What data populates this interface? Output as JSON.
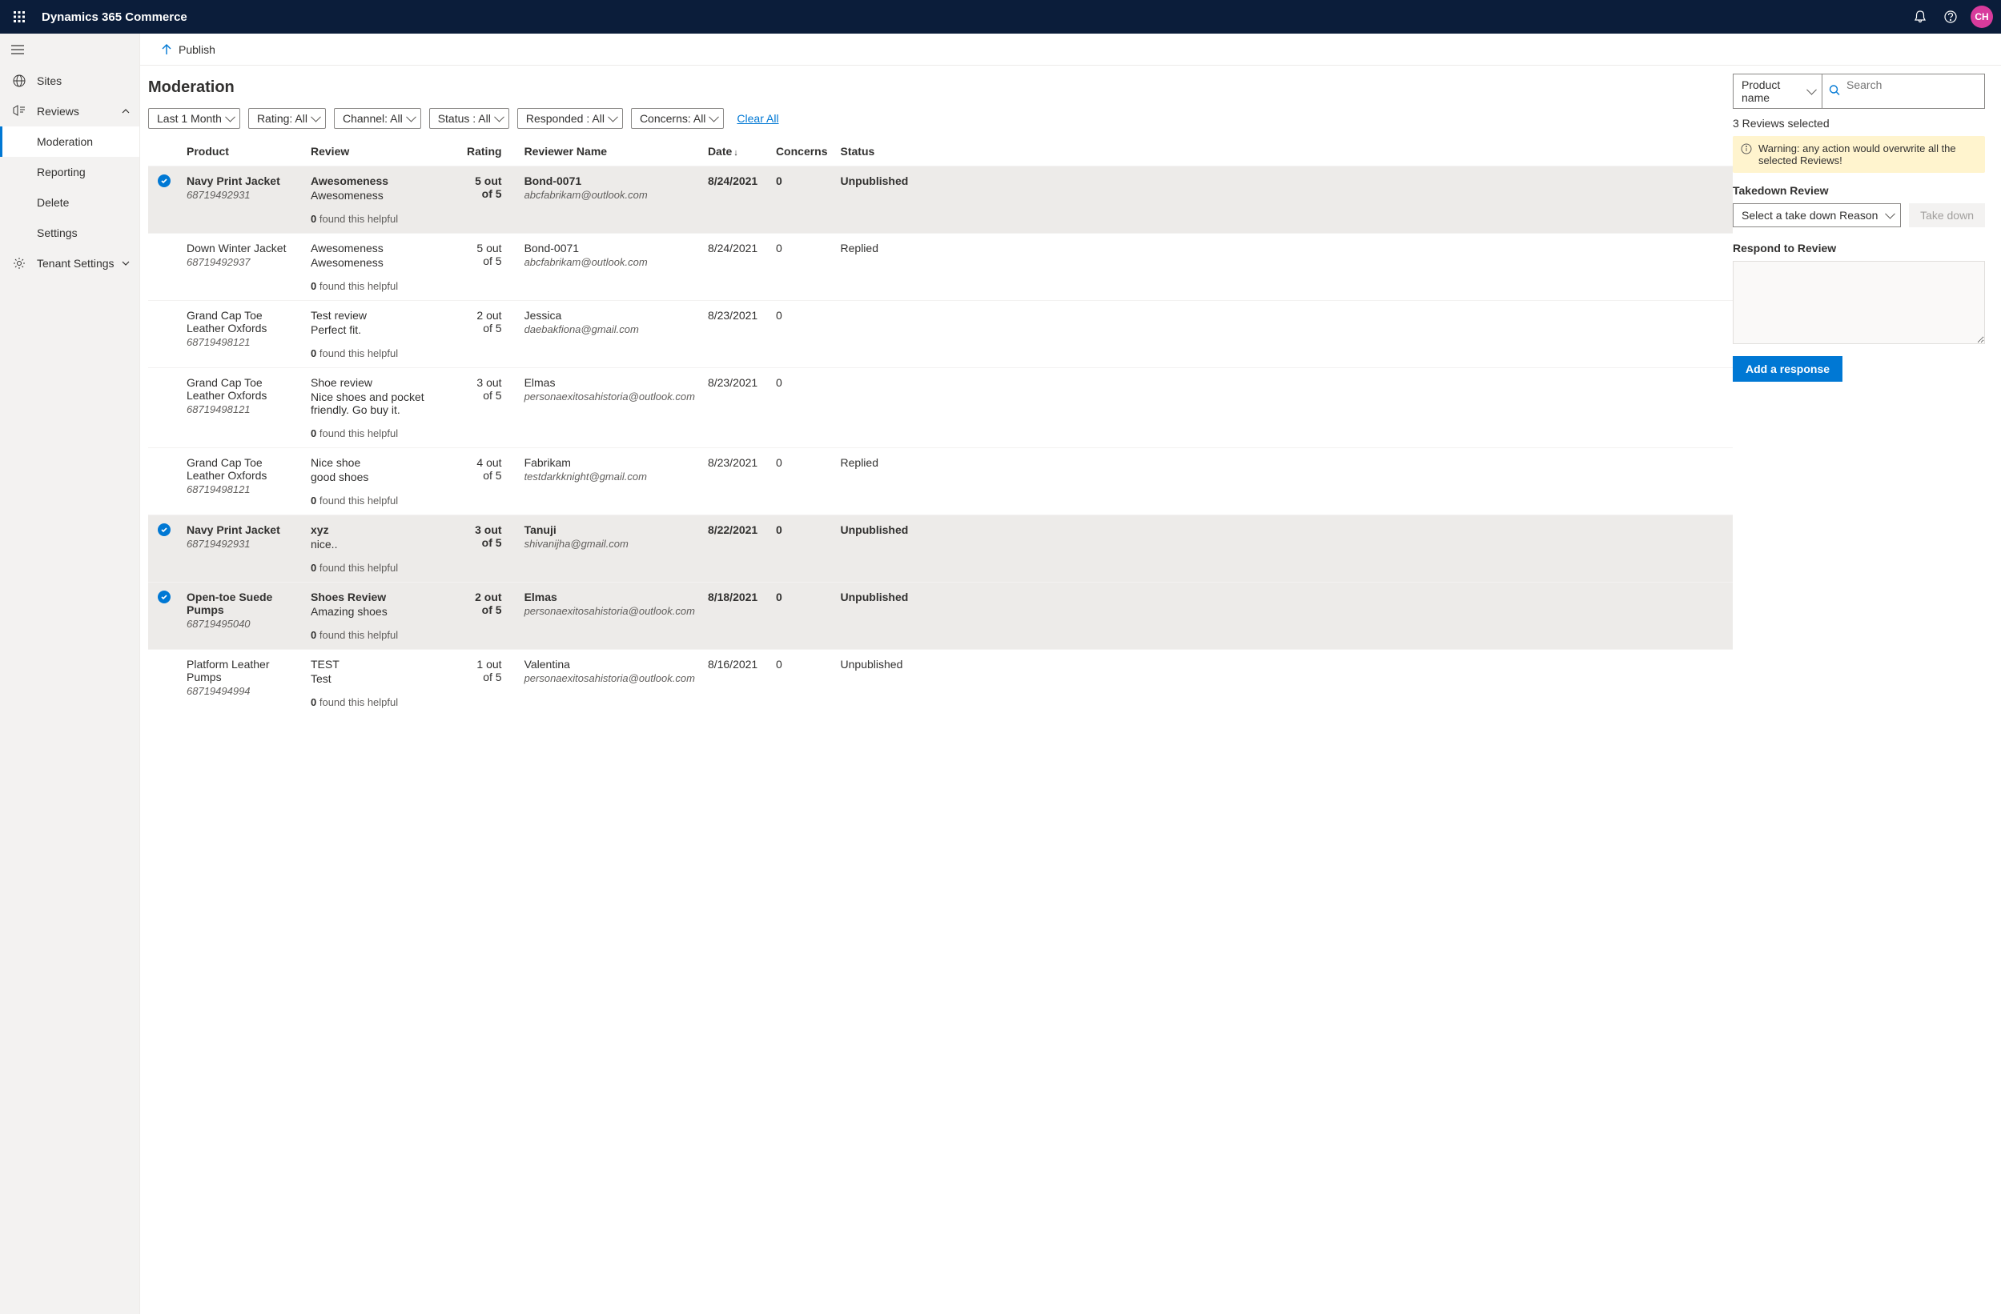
{
  "topbar": {
    "brand": "Dynamics 365 Commerce",
    "avatar_initials": "CH"
  },
  "sidebar": {
    "items": [
      {
        "label": "Sites",
        "icon": "globe"
      },
      {
        "label": "Reviews",
        "icon": "reviews",
        "expanded": true,
        "children": [
          {
            "label": "Moderation",
            "active": true
          },
          {
            "label": "Reporting"
          },
          {
            "label": "Delete"
          },
          {
            "label": "Settings"
          }
        ]
      },
      {
        "label": "Tenant Settings",
        "icon": "gear",
        "expanded": false
      }
    ]
  },
  "publish": {
    "label": "Publish"
  },
  "page": {
    "title": "Moderation"
  },
  "filters": [
    {
      "label": "Last 1 Month"
    },
    {
      "label": "Rating: All"
    },
    {
      "label": "Channel: All"
    },
    {
      "label": "Status : All"
    },
    {
      "label": "Responded : All"
    },
    {
      "label": "Concerns: All"
    }
  ],
  "clear_all": "Clear All",
  "table": {
    "headers": {
      "product": "Product",
      "review": "Review",
      "rating": "Rating",
      "reviewer": "Reviewer Name",
      "date": "Date",
      "concerns": "Concerns",
      "status": "Status"
    },
    "helpful_prefix": "0",
    "helpful_suffix": " found this helpful",
    "rows": [
      {
        "selected": true,
        "product": "Navy Print Jacket",
        "sku": "68719492931",
        "title": "Awesomeness",
        "body": "Awesomeness",
        "rating": "5 out of 5",
        "reviewer": "Bond-0071",
        "email": "abcfabrikam@outlook.com",
        "date": "8/24/2021",
        "concerns": "0",
        "status": "Unpublished"
      },
      {
        "selected": false,
        "product": "Down Winter Jacket",
        "sku": "68719492937",
        "title": "Awesomeness",
        "body": "Awesomeness",
        "rating": "5 out of 5",
        "reviewer": "Bond-0071",
        "email": "abcfabrikam@outlook.com",
        "date": "8/24/2021",
        "concerns": "0",
        "status": "Replied"
      },
      {
        "selected": false,
        "product": "Grand Cap Toe Leather Oxfords",
        "sku": "68719498121",
        "title": "Test review",
        "body": "Perfect fit.",
        "rating": "2 out of 5",
        "reviewer": "Jessica",
        "email": "daebakfiona@gmail.com",
        "date": "8/23/2021",
        "concerns": "0",
        "status": ""
      },
      {
        "selected": false,
        "product": "Grand Cap Toe Leather Oxfords",
        "sku": "68719498121",
        "title": "Shoe review",
        "body": "Nice shoes and pocket friendly. Go buy it.",
        "rating": "3 out of 5",
        "reviewer": "Elmas",
        "email": "personaexitosahistoria@outlook.com",
        "date": "8/23/2021",
        "concerns": "0",
        "status": ""
      },
      {
        "selected": false,
        "product": "Grand Cap Toe Leather Oxfords",
        "sku": "68719498121",
        "title": "Nice shoe",
        "body": "good shoes",
        "rating": "4 out of 5",
        "reviewer": "Fabrikam",
        "email": "testdarkknight@gmail.com",
        "date": "8/23/2021",
        "concerns": "0",
        "status": "Replied"
      },
      {
        "selected": true,
        "product": "Navy Print Jacket",
        "sku": "68719492931",
        "title": "xyz",
        "body": "nice..",
        "rating": "3 out of 5",
        "reviewer": "Tanuji",
        "email": "shivanijha@gmail.com",
        "date": "8/22/2021",
        "concerns": "0",
        "status": "Unpublished"
      },
      {
        "selected": true,
        "product": "Open-toe Suede Pumps",
        "sku": "68719495040",
        "title": "Shoes Review",
        "body": "Amazing shoes",
        "rating": "2 out of 5",
        "reviewer": "Elmas",
        "email": "personaexitosahistoria@outlook.com",
        "date": "8/18/2021",
        "concerns": "0",
        "status": "Unpublished"
      },
      {
        "selected": false,
        "product": "Platform Leather Pumps",
        "sku": "68719494994",
        "title": "TEST",
        "body": "Test",
        "rating": "1 out of 5",
        "reviewer": "Valentina",
        "email": "personaexitosahistoria@outlook.com",
        "date": "8/16/2021",
        "concerns": "0",
        "status": "Unpublished"
      }
    ]
  },
  "panel": {
    "search_type": "Product name",
    "search_placeholder": "Search",
    "selected_text": "3 Reviews selected",
    "warning": "Warning: any action would overwrite all the selected Reviews!",
    "takedown_title": "Takedown Review",
    "takedown_placeholder": "Select a take down Reason",
    "takedown_button": "Take down",
    "respond_title": "Respond to Review",
    "add_response": "Add a response"
  }
}
